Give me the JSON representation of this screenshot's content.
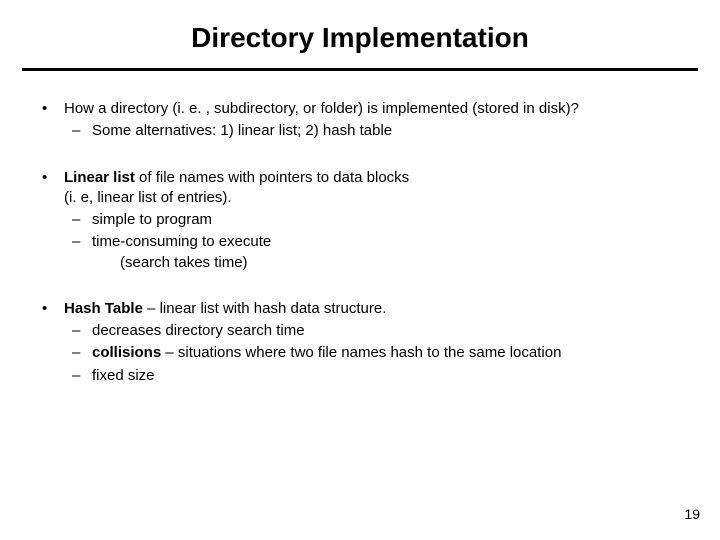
{
  "title": "Directory Implementation",
  "bullets": {
    "b1": {
      "text": "How a directory (i. e. , subdirectory, or folder)  is implemented (stored in disk)?",
      "sub1": "Some alternatives: 1) linear list; 2) hash table"
    },
    "b2": {
      "lead_bold": "Linear list",
      "lead_rest": " of file names with pointers to data blocks",
      "line2": "(i. e,  linear list of entries).",
      "sub1": "simple to program",
      "sub2": "time-consuming to execute",
      "sub2_extra": "(search takes time)"
    },
    "b3": {
      "lead_bold": "Hash Table",
      "lead_rest": " – linear list with hash data structure.",
      "sub1": "decreases directory search time",
      "sub2_bold": "collisions",
      "sub2_rest": " – situations where two file names hash to the same location",
      "sub3": "fixed size"
    }
  },
  "page_number": "19"
}
